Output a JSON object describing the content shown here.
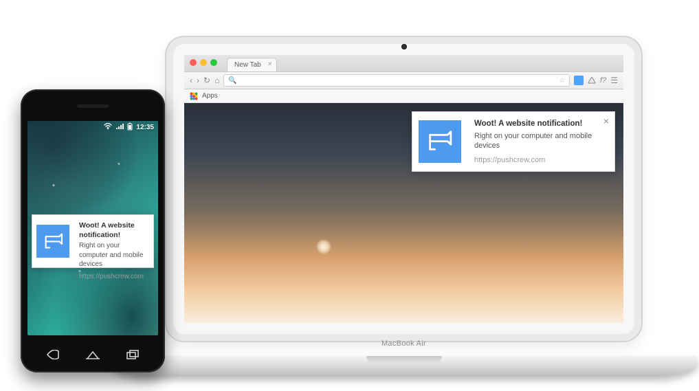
{
  "laptop": {
    "brand": "MacBook Air",
    "browser": {
      "tab_label": "New Tab",
      "bookmark_apps_label": "Apps",
      "url_field_placeholder": ""
    }
  },
  "notification_desktop": {
    "title": "Woot! A website notification!",
    "message": "Right on your computer and mobile devices",
    "source_url": "https://pushcrew.com"
  },
  "notification_mobile": {
    "title": "Woot! A website notification!",
    "message": "Right on your computer and mobile devices",
    "source_url": "https://pushcrew.com"
  },
  "phone": {
    "status_time": "12:35"
  },
  "colors": {
    "notification_icon_bg": "#4e9af0"
  }
}
